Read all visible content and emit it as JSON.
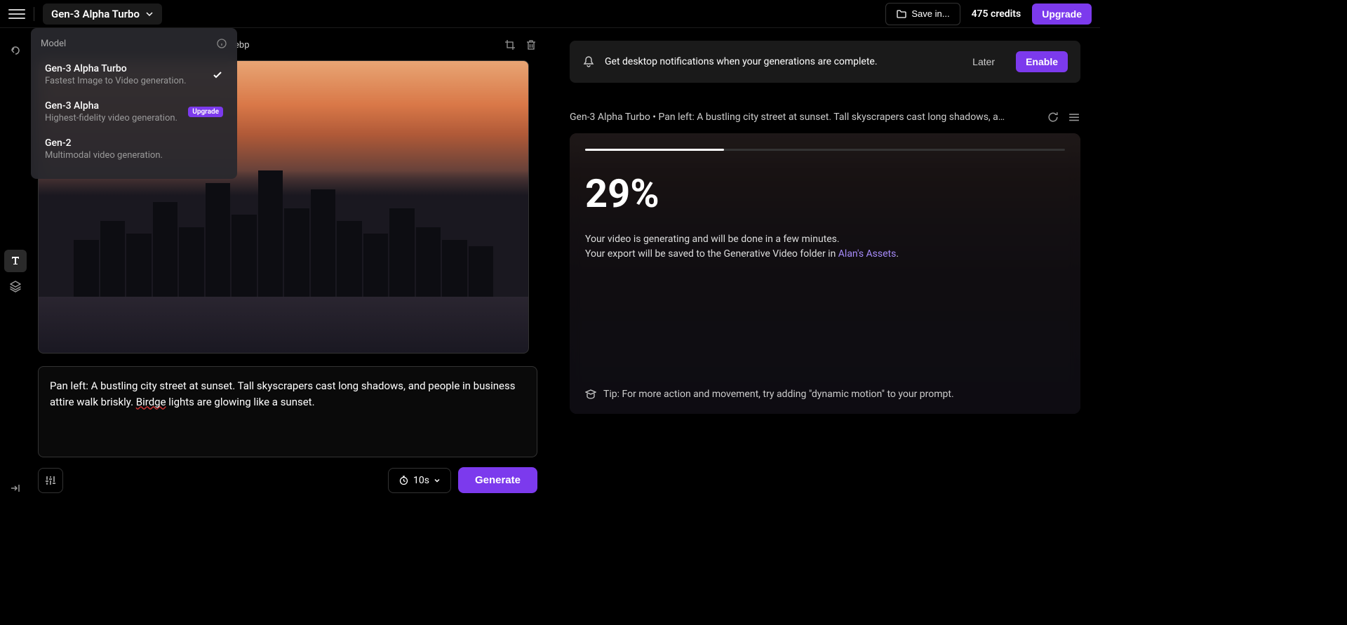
{
  "topbar": {
    "model_name": "Gen-3 Alpha Turbo",
    "save_in": "Save in...",
    "credits": "475 credits",
    "upgrade": "Upgrade"
  },
  "model_dropdown": {
    "header": "Model",
    "options": [
      {
        "title": "Gen-3 Alpha Turbo",
        "desc": "Fastest Image to Video generation.",
        "selected": true
      },
      {
        "title": "Gen-3 Alpha",
        "desc": "Highest-fidelity video generation.",
        "badge": "Upgrade"
      },
      {
        "title": "Gen-2",
        "desc": "Multimodal video generation."
      }
    ]
  },
  "left_panel": {
    "filename_suffix": "ebp",
    "prompt": "Pan left: A bustling city street at sunset. Tall skyscrapers cast long shadows, and people in business attire walk briskly. Birdge lights are glowing like a sunset.",
    "duration": "10s",
    "generate": "Generate"
  },
  "notification": {
    "text": "Get desktop notifications when your generations are complete.",
    "later": "Later",
    "enable": "Enable"
  },
  "generation": {
    "title": "Gen-3 Alpha Turbo • Pan left: A bustling city street at sunset. Tall skyscrapers cast long shadows, a…",
    "progress_pct": 29,
    "progress_label": "29%",
    "msg_line1": "Your video is generating and will be done in a few minutes.",
    "msg_line2_pre": "Your export will be saved to the Generative Video folder in ",
    "assets_link": "Alan's Assets",
    "msg_line2_post": ".",
    "tip": "Tip: For more action and movement, try adding \"dynamic motion\" to your prompt."
  }
}
